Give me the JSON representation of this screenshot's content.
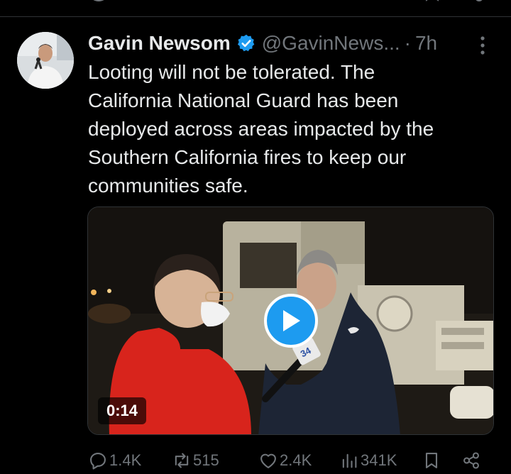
{
  "tweet": {
    "author": {
      "display_name": "Gavin Newsom",
      "handle": "@GavinNews...",
      "verified": true,
      "avatar_icon": "avatar-photo"
    },
    "separator": "·",
    "time": "7h",
    "text_lines": [
      "Looting will not be tolerated. The",
      "California National Guard has been",
      "deployed across areas impacted by the",
      "Southern California fires to keep our",
      "communities safe."
    ],
    "media": {
      "type": "video",
      "duration": "0:14",
      "play_icon": "play-icon",
      "mic_flag_text": "34"
    },
    "actions": {
      "replies": "1.4K",
      "retweets": "515",
      "likes": "2.4K",
      "views": "341K"
    }
  },
  "colors": {
    "background": "#000000",
    "text": "#e7e9ea",
    "muted": "#71767b",
    "accent": "#1d9bf0"
  }
}
